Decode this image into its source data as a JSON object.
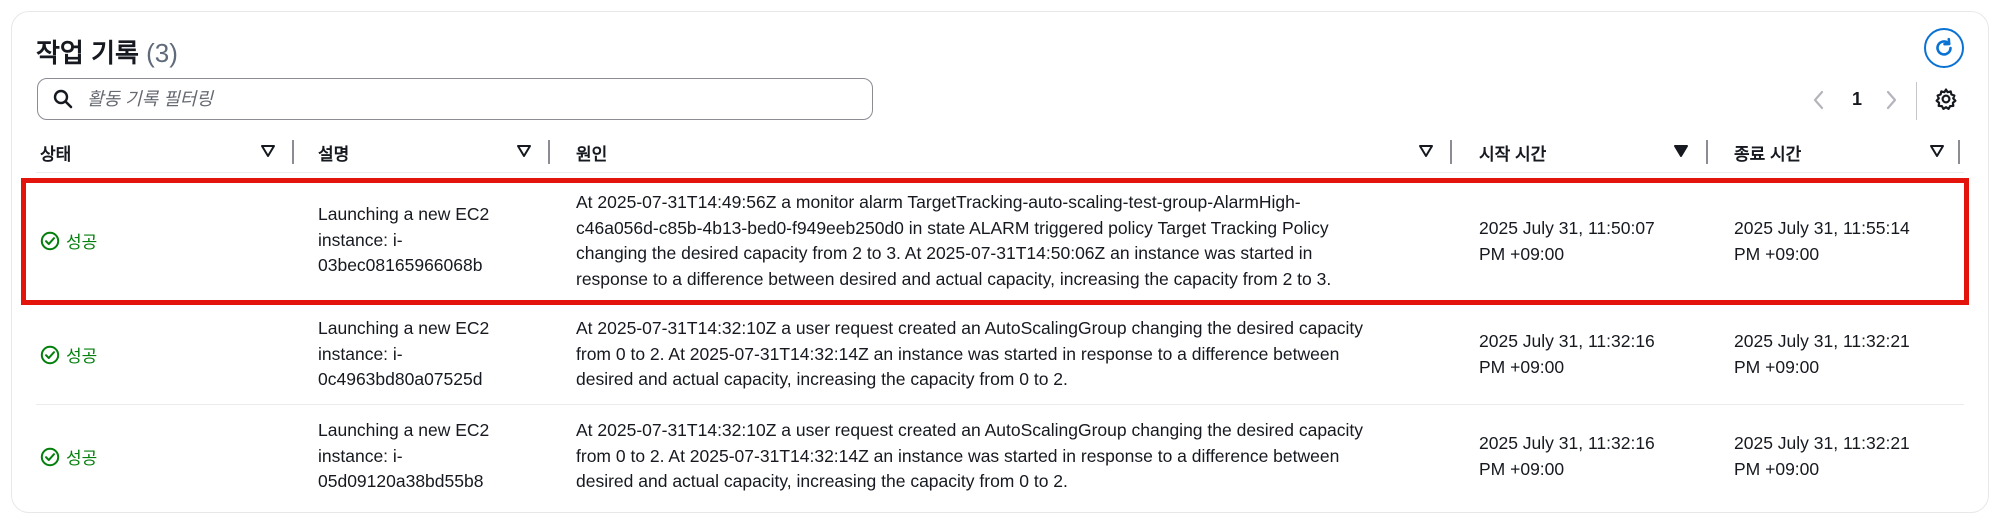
{
  "header": {
    "title": "작업 기록",
    "count": "(3)"
  },
  "search": {
    "placeholder": "활동 기록 필터링"
  },
  "pagination": {
    "current_page": "1"
  },
  "columns": [
    "상태",
    "설명",
    "원인",
    "시작 시간",
    "종료 시간"
  ],
  "rows": [
    {
      "status": "성공",
      "description": [
        "Launching a new EC2",
        "instance: i-",
        "03bec08165966068b"
      ],
      "cause": [
        "At 2025-07-31T14:49:56Z a monitor alarm TargetTracking-auto-scaling-test-group-AlarmHigh-",
        "c46a056d-c85b-4b13-bed0-f949eeb250d0 in state ALARM triggered policy Target Tracking Policy",
        "changing the desired capacity from 2 to 3. At 2025-07-31T14:50:06Z an instance was started in",
        "response to a difference between desired and actual capacity, increasing the capacity from 2 to 3."
      ],
      "start_time": [
        "2025 July 31, 11:50:07",
        "PM +09:00"
      ],
      "end_time": [
        "2025 July 31, 11:55:14",
        "PM +09:00"
      ]
    },
    {
      "status": "성공",
      "description": [
        "Launching a new EC2",
        "instance: i-",
        "0c4963bd80a07525d"
      ],
      "cause": [
        "At 2025-07-31T14:32:10Z a user request created an AutoScalingGroup changing the desired capacity",
        "from 0 to 2. At 2025-07-31T14:32:14Z an instance was started in response to a difference between",
        "desired and actual capacity, increasing the capacity from 0 to 2."
      ],
      "start_time": [
        "2025 July 31, 11:32:16",
        "PM +09:00"
      ],
      "end_time": [
        "2025 July 31, 11:32:21",
        "PM +09:00"
      ]
    },
    {
      "status": "성공",
      "description": [
        "Launching a new EC2",
        "instance: i-",
        "05d09120a38bd55b8"
      ],
      "cause": [
        "At 2025-07-31T14:32:10Z a user request created an AutoScalingGroup changing the desired capacity",
        "from 0 to 2. At 2025-07-31T14:32:14Z an instance was started in response to a difference between",
        "desired and actual capacity, increasing the capacity from 0 to 2."
      ],
      "start_time": [
        "2025 July 31, 11:32:16",
        "PM +09:00"
      ],
      "end_time": [
        "2025 July 31, 11:32:21",
        "PM +09:00"
      ]
    }
  ],
  "colors": {
    "accent": "#0972d3",
    "success": "#037f0c",
    "highlight": "#e3140b"
  }
}
